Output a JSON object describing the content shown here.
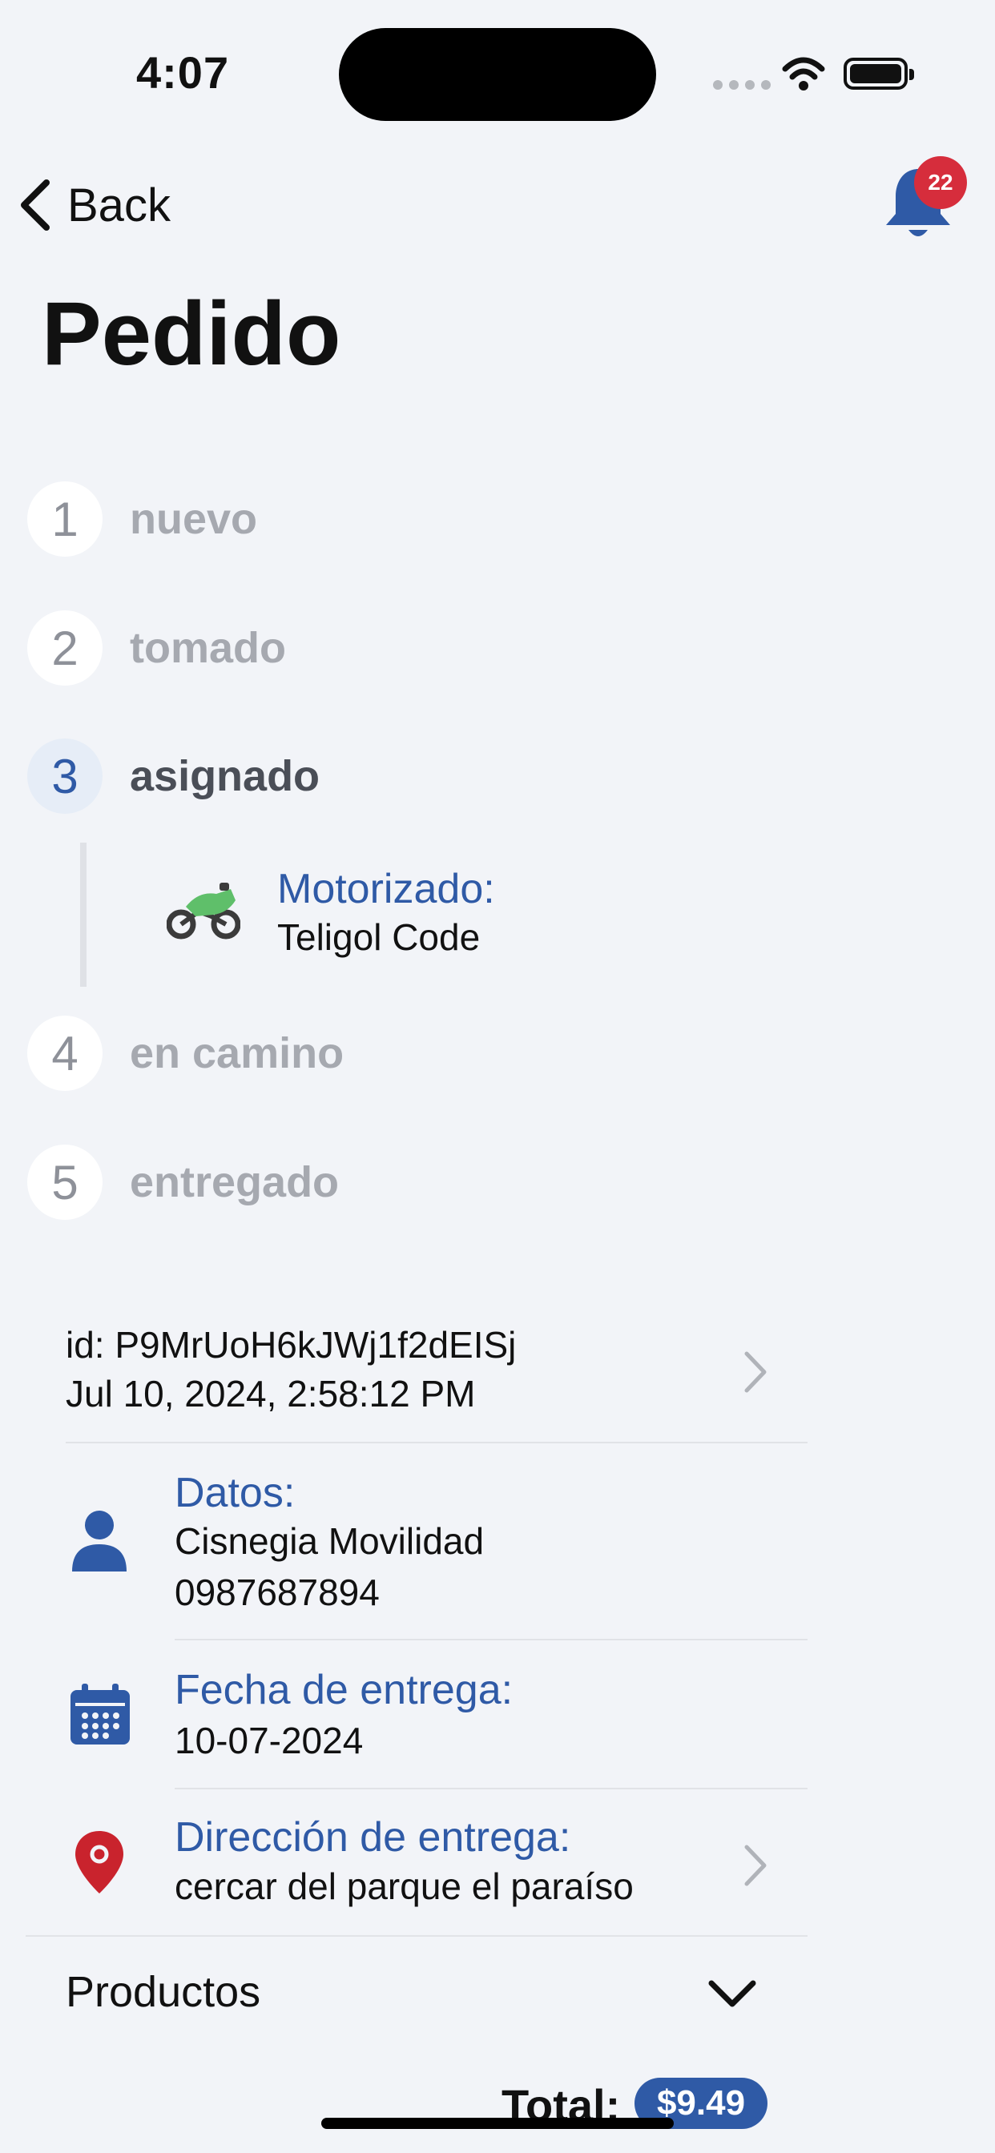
{
  "status_bar": {
    "time": "4:07"
  },
  "nav": {
    "back_label": "Back",
    "notification_count": "22"
  },
  "page": {
    "title": "Pedido"
  },
  "steps": [
    {
      "number": "1",
      "label": "nuevo"
    },
    {
      "number": "2",
      "label": "tomado"
    },
    {
      "number": "3",
      "label": "asignado",
      "active": true
    },
    {
      "number": "4",
      "label": "en camino"
    },
    {
      "number": "5",
      "label": "entregado"
    }
  ],
  "courier": {
    "title": "Motorizado:",
    "name": "Teligol Code"
  },
  "order": {
    "id_line": "id: P9MrUoH6kJWj1f2dEISj",
    "datetime": "Jul 10, 2024, 2:58:12 PM"
  },
  "customer": {
    "title": "Datos:",
    "name": "Cisnegia Movilidad",
    "phone": "0987687894"
  },
  "delivery_date": {
    "title": "Fecha de entrega:",
    "value": "10-07-2024"
  },
  "delivery_address": {
    "title": "Dirección de entrega:",
    "value": "cercar del parque el paraíso"
  },
  "products": {
    "label": "Productos"
  },
  "total": {
    "label": "Total:",
    "amount": "$9.49"
  },
  "colors": {
    "accent": "#2f5aa6",
    "badge": "#d62d3c",
    "pin": "#c9232d",
    "moto": "#5fbf6a"
  }
}
